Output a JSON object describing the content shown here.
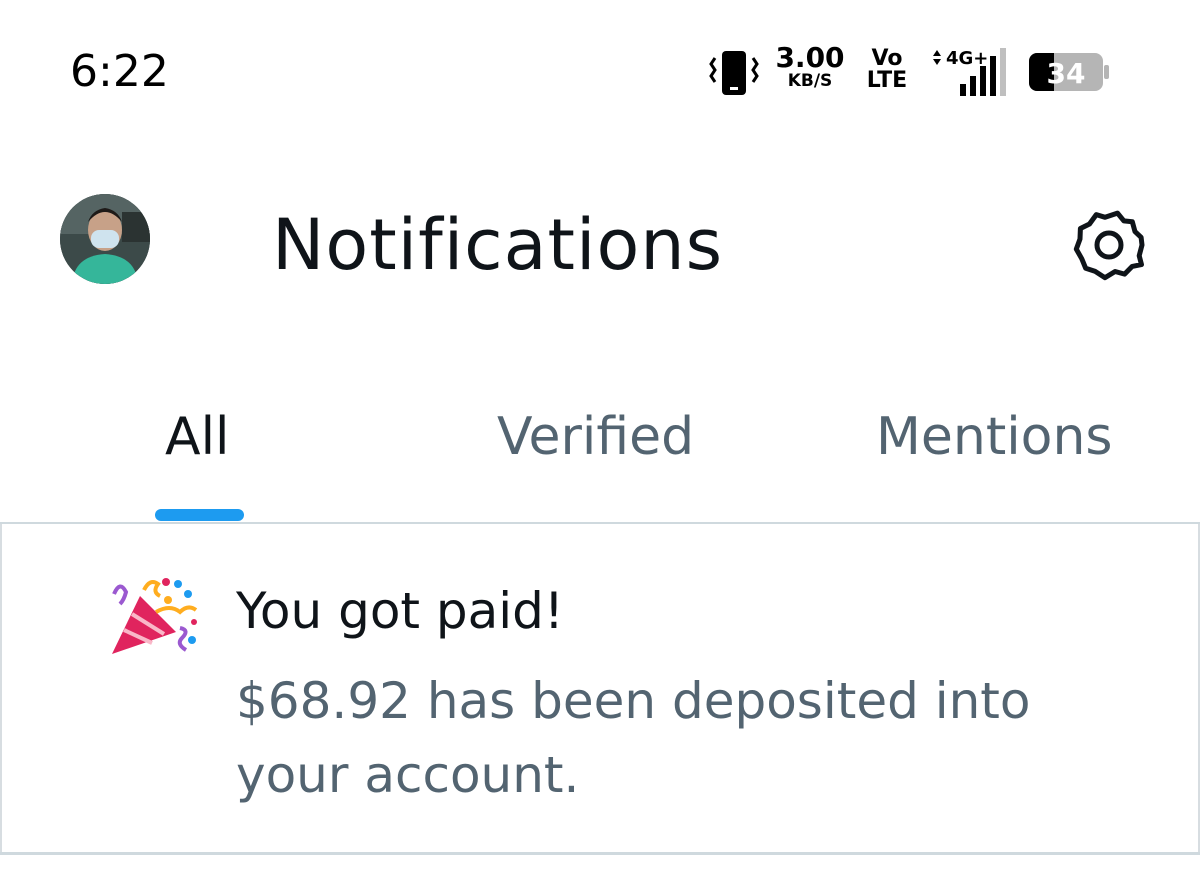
{
  "status_bar": {
    "time": "6:22",
    "speed_value": "3.00",
    "speed_unit": "KB/S",
    "volte_top": "Vo",
    "volte_bottom": "LTE",
    "network": "4G+",
    "battery": "34",
    "icons": [
      "vibrate-icon",
      "signal-icon",
      "battery-icon"
    ]
  },
  "header": {
    "title": "Notifications",
    "icons": [
      "avatar",
      "settings-gear-icon"
    ]
  },
  "tabs": [
    {
      "label": "All",
      "active": true
    },
    {
      "label": "Verified",
      "active": false
    },
    {
      "label": "Mentions",
      "active": false
    }
  ],
  "notifications": [
    {
      "icon": "party-popper-icon",
      "title": "You got paid!",
      "body": "$68.92 has been deposited into your account."
    }
  ],
  "colors": {
    "accent": "#1d9bf0",
    "text_primary": "#0f1419",
    "text_secondary": "#536471",
    "divider": "#cfd9de"
  }
}
